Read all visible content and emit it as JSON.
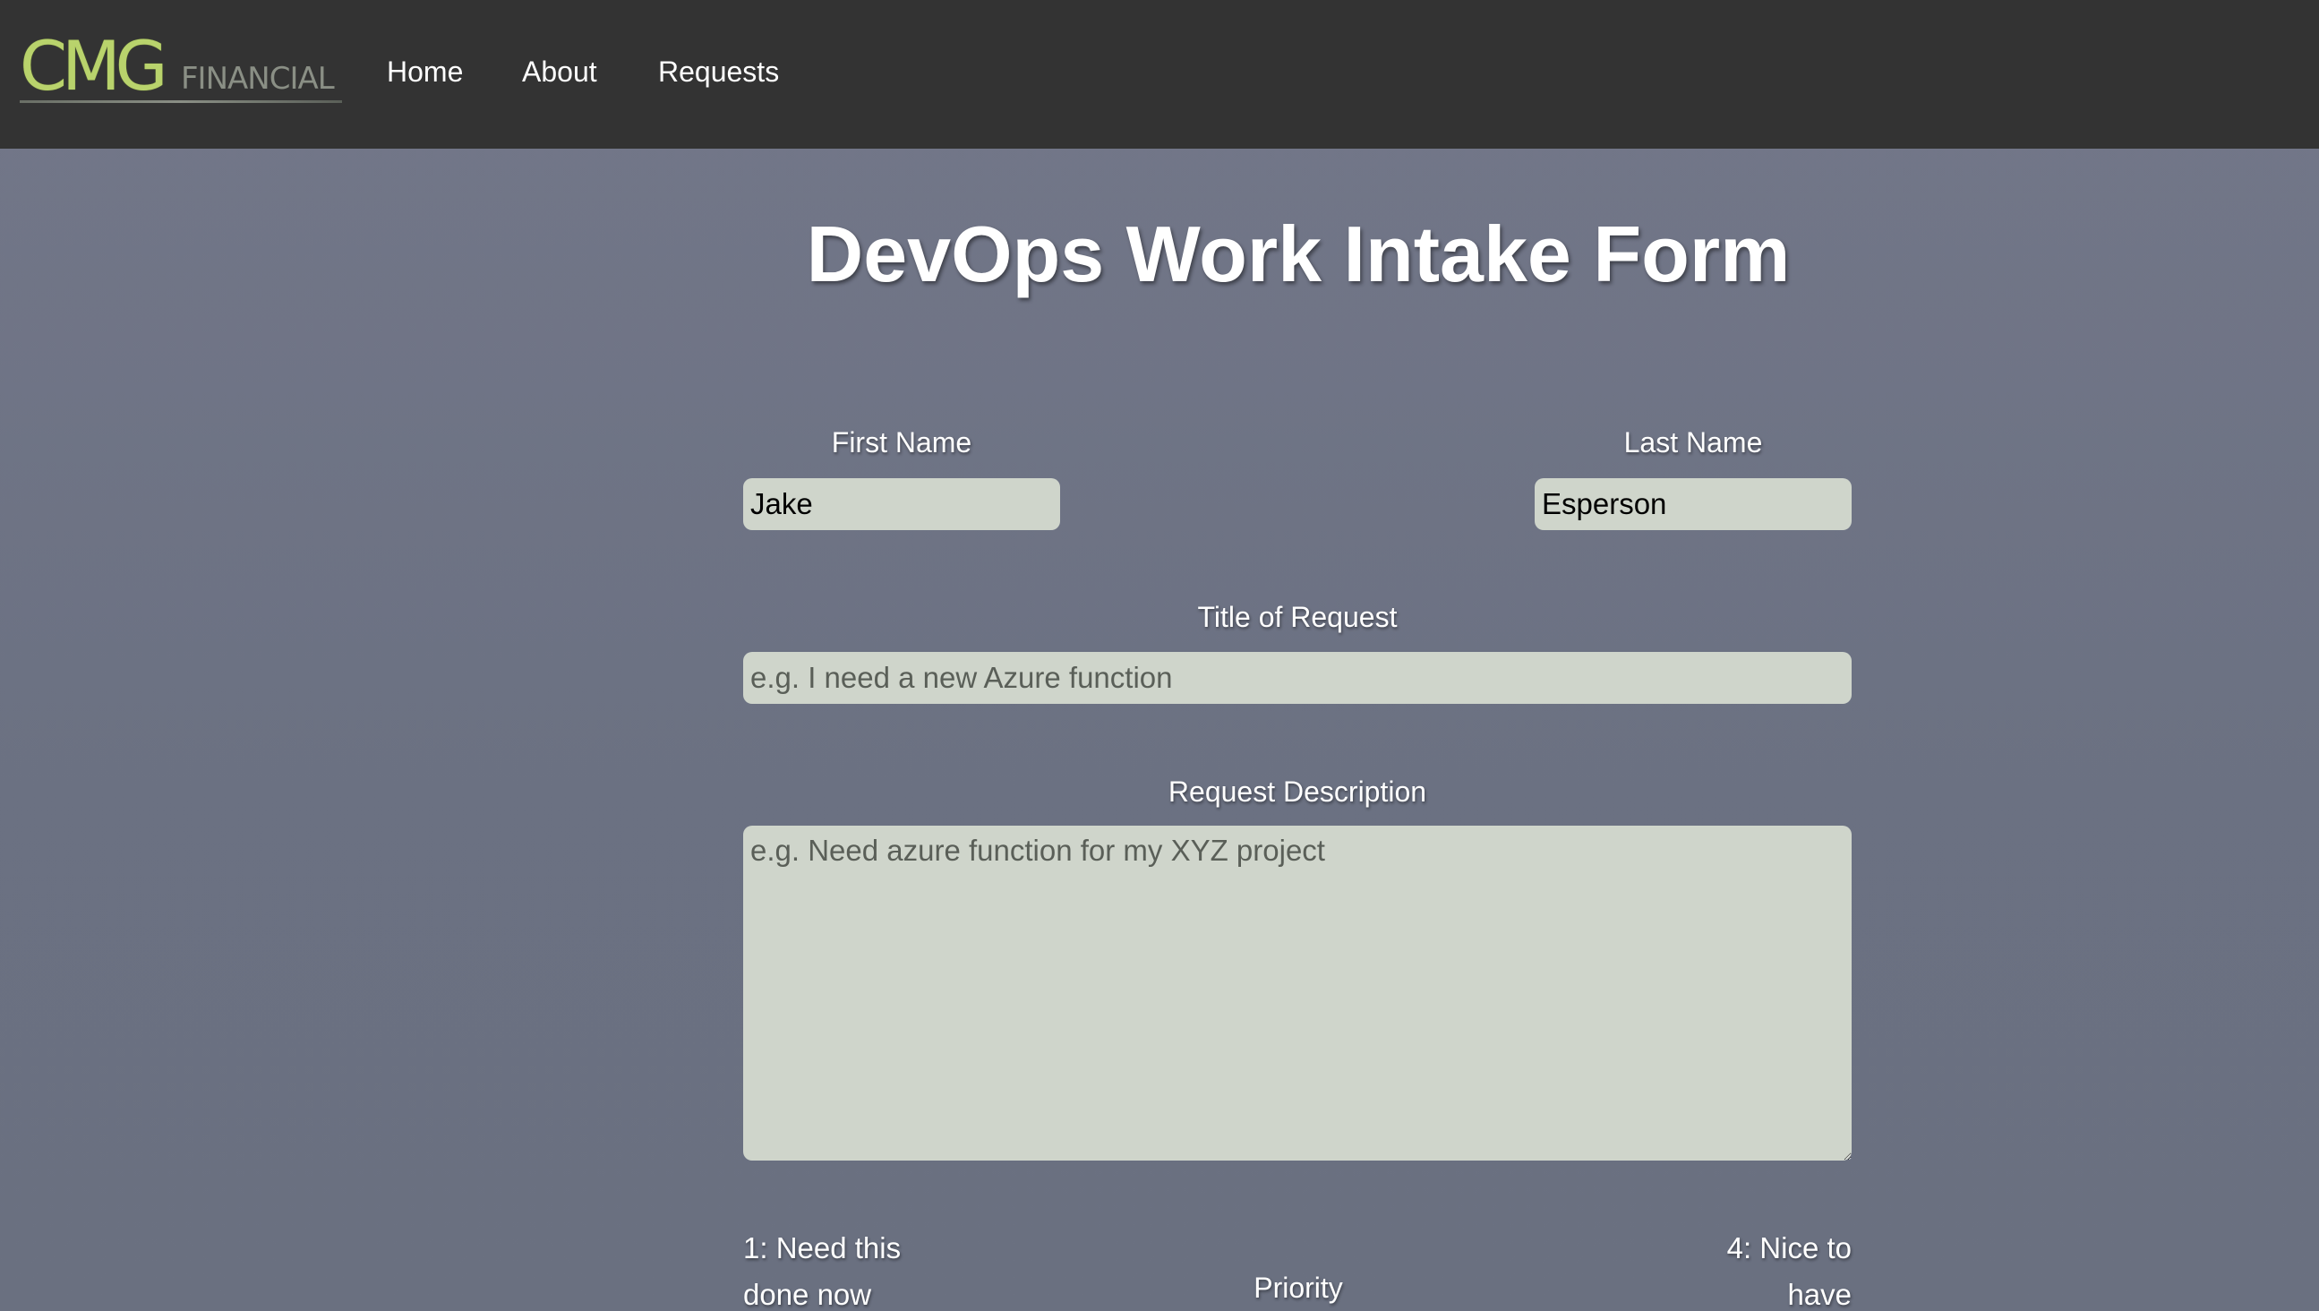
{
  "nav": {
    "logo_primary": "CMG",
    "logo_secondary": "FINANCIAL",
    "links": [
      {
        "label": "Home"
      },
      {
        "label": "About"
      },
      {
        "label": "Requests"
      }
    ]
  },
  "form": {
    "title": "DevOps Work Intake Form",
    "first_name": {
      "label": "First Name",
      "value": "Jake"
    },
    "last_name": {
      "label": "Last Name",
      "value": "Esperson"
    },
    "request_title": {
      "label": "Title of Request",
      "placeholder": "e.g. I need a new Azure function"
    },
    "description": {
      "label": "Request Description",
      "placeholder": "e.g. Need azure function for my XYZ project"
    },
    "priority": {
      "label": "Priority",
      "min_label": "1: Need this done now",
      "max_label": "4: Nice to have"
    }
  },
  "colors": {
    "navbar": "#333333",
    "logo_green": "#b9d36c",
    "input_bg": "#cfd5cb",
    "page_bg": "#6e7383"
  }
}
